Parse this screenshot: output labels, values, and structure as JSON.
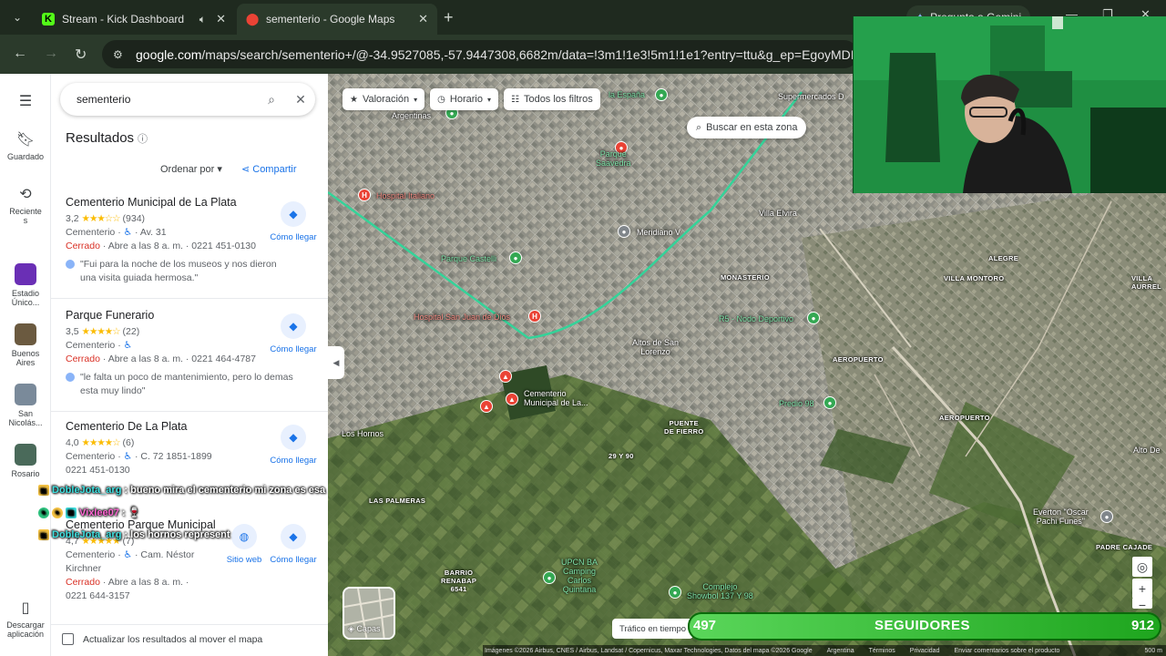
{
  "browser": {
    "tabs": [
      {
        "title": "Stream - Kick Dashboard",
        "favicon": "kick-icon",
        "audio": true
      },
      {
        "title": "sementerio - Google Maps",
        "favicon": "google-maps-icon",
        "active": true
      }
    ],
    "gemini_label": "Pregunta a Gemini",
    "url_domain": "google.com",
    "url_rest": "/maps/search/sementerio+/@-34.9527085,-57.9447308,6682m/data=!3m1!1e3!5m1!1e1?entry=ttu&g_ep=EgoyMDI2MDgxM"
  },
  "rail": {
    "menu_icon": "menu-icon",
    "saved": "Guardado",
    "recent": "Reciente\ns",
    "recent_places": [
      {
        "label": "Estadio\nÚnico...",
        "color": "#6a2fb5"
      },
      {
        "label": "Buenos\nAires",
        "color": "#6b5a40"
      },
      {
        "label": "San\nNicolás...",
        "color": "#7a8a9a"
      },
      {
        "label": "Rosario",
        "color": "#4a6a5a"
      }
    ],
    "download": "Descargar\naplicación"
  },
  "panel": {
    "query": "sementerio",
    "results_title": "Resultados",
    "sort_label": "Ordenar por",
    "share_label": "Compartir",
    "directions_label": "Cómo llegar",
    "website_label": "Sitio web",
    "update_label": "Actualizar los resultados al mover el mapa",
    "places": [
      {
        "name": "Cementerio Municipal de La Plata",
        "rating": "3,2",
        "stars": "★★★☆☆",
        "reviews": "(934)",
        "type": "Cementerio",
        "address": "Av. 31",
        "status": "Cerrado",
        "hours": " · Abre a las 8 a. m. · 0221 451-0130",
        "review": "\"Fui para la noche de los museos y nos dieron una visita guiada hermosa.\""
      },
      {
        "name": "Parque Funerario",
        "rating": "3,5",
        "stars": "★★★★☆",
        "reviews": "(22)",
        "type": "Cementerio",
        "address": "",
        "status": "Cerrado",
        "hours": " · Abre a las 8 a. m. · 0221 464-4787",
        "review": "\"le falta un poco de mantenimiento, pero lo demas esta muy lindo\""
      },
      {
        "name": "Cementerio De La Plata",
        "rating": "4,0",
        "stars": "★★★★☆",
        "reviews": "(6)",
        "type": "Cementerio",
        "address": "C. 72 1851-1899",
        "phone": "0221 451-0130"
      },
      {
        "name": "Cementerio Parque Municipal",
        "rating": "4,7",
        "stars": "★★★★★",
        "reviews": "(7)",
        "type": "Cementerio",
        "address": "Cam. Néstor Kirchner",
        "status": "Cerrado",
        "hours": " · Abre a las 8 a. m. ·",
        "phone": "0221 644-3157"
      }
    ]
  },
  "map": {
    "chips": [
      "Valoración",
      "Horario",
      "Todos los filtros"
    ],
    "search_area": "Buscar en esta zona",
    "layers": "Capas",
    "traffic": "Tráfico en tiempo",
    "scale": "500 m",
    "attribution": [
      "Imágenes ©2026 Airbus, CNES / Airbus, Landsat / Copernicus, Maxar Technologies, Datos del mapa ©2026 Google",
      "Argentina",
      "Términos",
      "Privacidad",
      "Enviar comentarios sobre el producto"
    ],
    "labels": {
      "espana": "la España",
      "argentinas": "Argentinas",
      "supermercados": "Supermercados D",
      "parque_saavedra": "Parque\nSaavedra",
      "hospital_italiano": "Hospital Italiano",
      "villa_elvira": "Villa Elvira",
      "meridiano": "Meridiano V",
      "parque_castelli": "Parque Castelli",
      "alegre": "ALEGRE",
      "villa_montoro": "VILLA MONTORO",
      "villa_aurrel": "VILLA\nAURREL",
      "monasterio": "MONASTERIO",
      "hospital_sjd": "Hospital San Juan de Dios",
      "nodo_deportivo": "R5 - Nodo Deportivo",
      "altos": "Altos de San\nLorenzo",
      "aeropuerto1": "AEROPUERTO",
      "cementerio": "Cementerio\nMunicipal de La...",
      "predio": "Predio 98",
      "aeropuerto2": "AEROPUERTO",
      "los_hornos": "Los Hornos",
      "puente": "PUENTE\nDE FIERRO",
      "calle": "29 Y 90",
      "alto_de": "Alto De",
      "las_palmeras": "LAS PALMERAS",
      "everton": "Everton \"Oscar\nPachi Funes\"",
      "padre_cajade": "PADRE CAJADE",
      "barrio": "BARRIO\nRENABAP\n6541",
      "upcn": "UPCN BA\nCamping\nCarlos\nQuintana",
      "complejo": "Complejo\nShowbol 137 Y 98"
    }
  },
  "overlay": {
    "followers_current": "497",
    "followers_label": "SEGUIDORES",
    "followers_goal": "912",
    "chat": [
      {
        "user": "DobleJota_arg",
        "message": ": bueno mira el cementerio mi zona es esa"
      },
      {
        "user": "Vixlee07",
        "message": ": 🍷"
      },
      {
        "user": "DobleJota_arg",
        "message": ": los hornos represent"
      }
    ]
  }
}
